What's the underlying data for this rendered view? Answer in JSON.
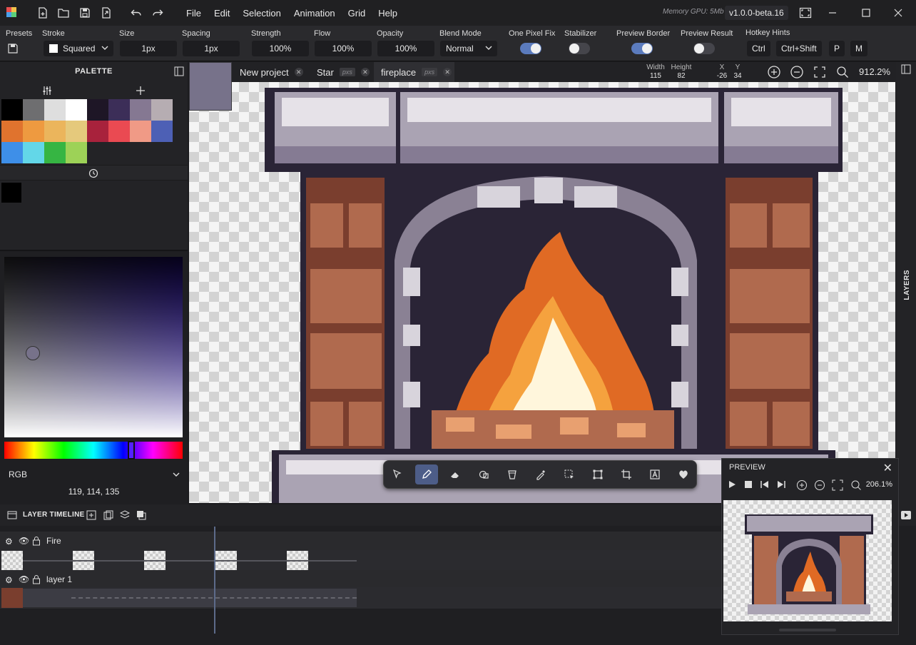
{
  "app": {
    "memory": "Memory GPU: 5Mb",
    "version": "v1.0.0-beta.16"
  },
  "menu": [
    "File",
    "Edit",
    "Selection",
    "Animation",
    "Grid",
    "Help"
  ],
  "toolbar": {
    "presets_label": "Presets",
    "stroke_label": "Stroke",
    "stroke_value": "Squared",
    "size_label": "Size",
    "size_value": "1px",
    "spacing_label": "Spacing",
    "spacing_value": "1px",
    "strength_label": "Strength",
    "strength_value": "100%",
    "flow_label": "Flow",
    "flow_value": "100%",
    "opacity_label": "Opacity",
    "opacity_value": "100%",
    "blend_label": "Blend Mode",
    "blend_value": "Normal",
    "pixel_fix_label": "One Pixel Fix",
    "pixel_fix_on": true,
    "stabilizer_label": "Stabilizer",
    "stabilizer_on": false,
    "preview_border_label": "Preview Border",
    "preview_border_on": true,
    "preview_result_label": "Preview Result",
    "preview_result_on": false,
    "hotkey_label": "Hotkey Hints",
    "hotkeys": [
      "Ctrl",
      "Ctrl+Shift",
      "P",
      "M"
    ]
  },
  "palette": {
    "title": "PALETTE",
    "colors": [
      "#000000",
      "#6e6e70",
      "#dedede",
      "#ffffff",
      "#1e1626",
      "#3c2e58",
      "#857892",
      "#b6adb2",
      "#e0732e",
      "#ee9a40",
      "#ebb55c",
      "#e5c97c",
      "#a8223c",
      "#ea4a52",
      "#f09a86",
      "#4d60b5",
      "#3e8fe8",
      "#63d7e8",
      "#36b543",
      "#9dd257"
    ],
    "current_color": "#000000"
  },
  "color_picker": {
    "mode": "RGB",
    "value": "119, 114, 135",
    "hue_fraction": 0.72
  },
  "tabs": [
    {
      "label": "New project",
      "ext": "",
      "active": false
    },
    {
      "label": "Star",
      "ext": "pxs",
      "active": false
    },
    {
      "label": "fireplace",
      "ext": "pxs",
      "active": true
    }
  ],
  "canvas_info": {
    "width_label": "Width",
    "width": "115",
    "height_label": "Height",
    "height": "82",
    "x_label": "X",
    "x": "-26",
    "y_label": "Y",
    "y": "34",
    "zoom": "912.2%"
  },
  "right_panel": {
    "label": "LAYERS"
  },
  "timeline": {
    "title": "LAYER TIMELINE",
    "layers": [
      {
        "name": "Fire"
      },
      {
        "name": "layer 1"
      }
    ]
  },
  "preview": {
    "title": "PREVIEW",
    "zoom": "206.1%"
  }
}
